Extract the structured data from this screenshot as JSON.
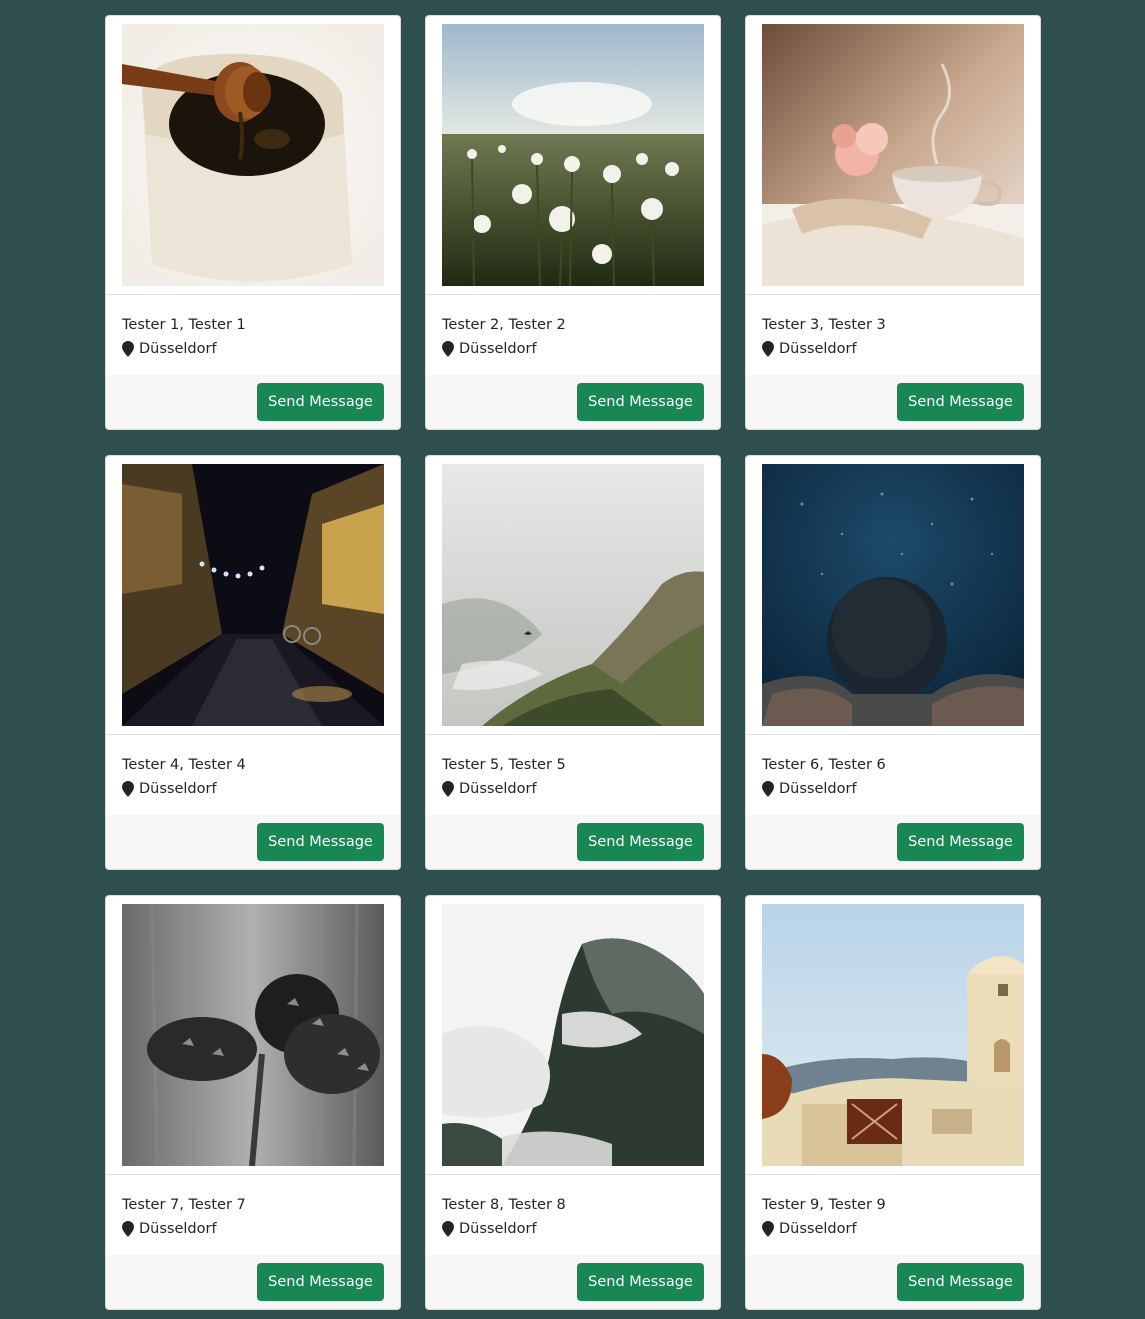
{
  "users": [
    {
      "name": "Tester 1, Tester 1",
      "location": "Düsseldorf",
      "button_label": "Send Message",
      "photo": "honey-pot"
    },
    {
      "name": "Tester 2, Tester 2",
      "location": "Düsseldorf",
      "button_label": "Send Message",
      "photo": "dandelion-field"
    },
    {
      "name": "Tester 3, Tester 3",
      "location": "Düsseldorf",
      "button_label": "Send Message",
      "photo": "teacup-book"
    },
    {
      "name": "Tester 4, Tester 4",
      "location": "Düsseldorf",
      "button_label": "Send Message",
      "photo": "night-street"
    },
    {
      "name": "Tester 5, Tester 5",
      "location": "Düsseldorf",
      "button_label": "Send Message",
      "photo": "foggy-cliff"
    },
    {
      "name": "Tester 6, Tester 6",
      "location": "Düsseldorf",
      "button_label": "Send Message",
      "photo": "underwater-swimmer"
    },
    {
      "name": "Tester 7, Tester 7",
      "location": "Düsseldorf",
      "button_label": "Send Message",
      "photo": "pine-cones"
    },
    {
      "name": "Tester 8, Tester 8",
      "location": "Düsseldorf",
      "button_label": "Send Message",
      "photo": "misty-mountain"
    },
    {
      "name": "Tester 9, Tester 9",
      "location": "Düsseldorf",
      "button_label": "Send Message",
      "photo": "santorini-terrace"
    }
  ],
  "colors": {
    "background": "#2f4f4f",
    "button": "#198754",
    "footer": "#f7f7f7"
  },
  "icons": {
    "location": "map-pin-icon"
  }
}
